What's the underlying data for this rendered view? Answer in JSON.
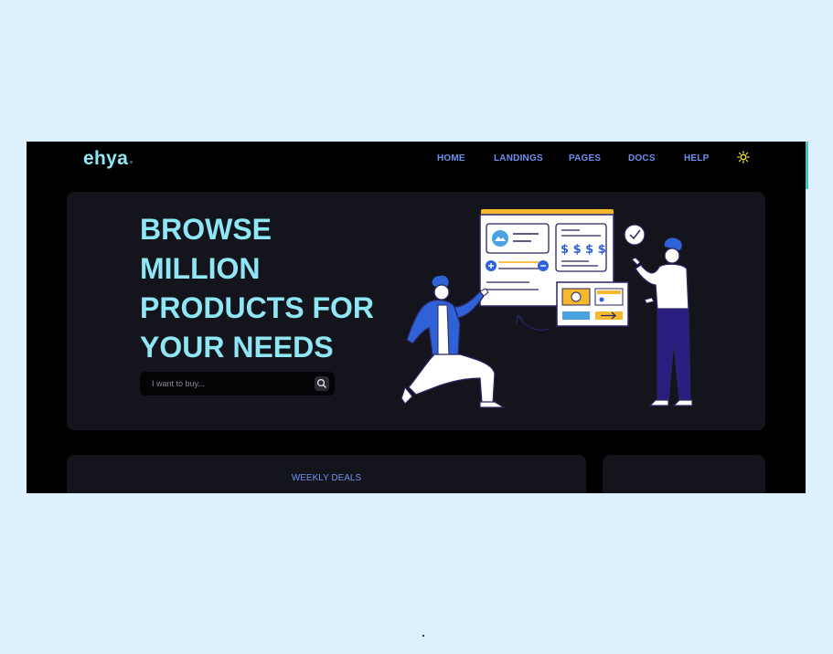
{
  "brand": {
    "name": "ehya"
  },
  "nav": {
    "items": [
      {
        "label": "HOME"
      },
      {
        "label": "LANDINGS"
      },
      {
        "label": "PAGES"
      },
      {
        "label": "DOCS"
      },
      {
        "label": "HELP"
      }
    ],
    "theme_toggle_icon": "sun-icon"
  },
  "hero": {
    "headline": "BROWSE MILLION PRODUCTS FOR YOUR NEEDS",
    "search": {
      "placeholder": "I want to buy...",
      "value": "",
      "button_icon": "search-icon"
    },
    "illustration_icon": "shopping-illustration",
    "illustration_text": {
      "price": "$ $ $ $"
    }
  },
  "sections": {
    "weekly_deals_title": "WEEKLY DEALS"
  },
  "colors": {
    "page_bg": "#ddf1fc",
    "app_bg": "#000000",
    "card_bg": "#14141c",
    "headline": "#8fe6f5",
    "nav_link": "#6f8ff0",
    "accent_yellow": "#f5b82e",
    "accent_blue": "#2f62d6"
  }
}
